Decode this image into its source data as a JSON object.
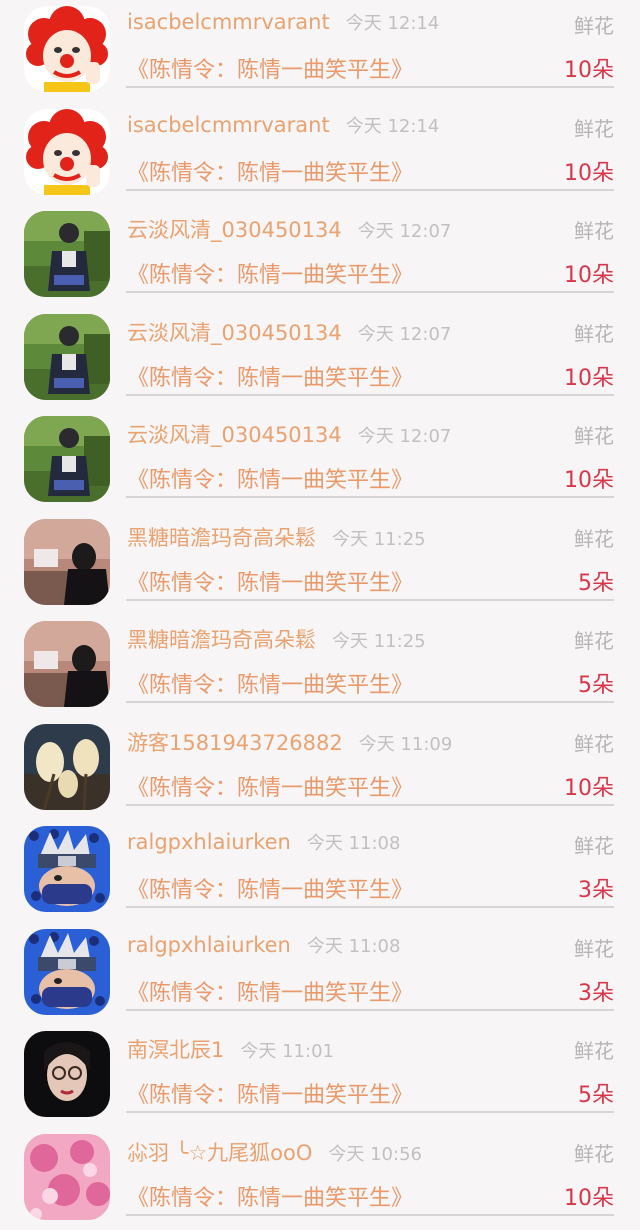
{
  "gift_list": [
    {
      "username": "isacbelcmmrvarant",
      "time": "今天 12:14",
      "gift_type": "鲜花",
      "work_title": "《陈情令：陈情一曲笑平生》",
      "count": "10朵",
      "avatar": "clown-avatar"
    },
    {
      "username": "isacbelcmmrvarant",
      "time": "今天 12:14",
      "gift_type": "鲜花",
      "work_title": "《陈情令：陈情一曲笑平生》",
      "count": "10朵",
      "avatar": "clown-avatar"
    },
    {
      "username": "云淡风清_030450134",
      "time": "今天 12:07",
      "gift_type": "鲜花",
      "work_title": "《陈情令：陈情一曲笑平生》",
      "count": "10朵",
      "avatar": "garden-person-avatar"
    },
    {
      "username": "云淡风清_030450134",
      "time": "今天 12:07",
      "gift_type": "鲜花",
      "work_title": "《陈情令：陈情一曲笑平生》",
      "count": "10朵",
      "avatar": "garden-person-avatar"
    },
    {
      "username": "云淡风清_030450134",
      "time": "今天 12:07",
      "gift_type": "鲜花",
      "work_title": "《陈情令：陈情一曲笑平生》",
      "count": "10朵",
      "avatar": "garden-person-avatar"
    },
    {
      "username": "黑糖暗澹玛奇高朵鬆",
      "time": "今天 11:25",
      "gift_type": "鲜花",
      "work_title": "《陈情令：陈情一曲笑平生》",
      "count": "5朵",
      "avatar": "dark-room-avatar"
    },
    {
      "username": "黑糖暗澹玛奇高朵鬆",
      "time": "今天 11:25",
      "gift_type": "鲜花",
      "work_title": "《陈情令：陈情一曲笑平生》",
      "count": "5朵",
      "avatar": "dark-room-avatar"
    },
    {
      "username": "游客1581943726882",
      "time": "今天 11:09",
      "gift_type": "鲜花",
      "work_title": "《陈情令：陈情一曲笑平生》",
      "count": "10朵",
      "avatar": "magnolia-avatar"
    },
    {
      "username": "ralgpxhlaiurken",
      "time": "今天 11:08",
      "gift_type": "鲜花",
      "work_title": "《陈情令：陈情一曲笑平生》",
      "count": "3朵",
      "avatar": "ninja-cartoon-avatar"
    },
    {
      "username": "ralgpxhlaiurken",
      "time": "今天 11:08",
      "gift_type": "鲜花",
      "work_title": "《陈情令：陈情一曲笑平生》",
      "count": "3朵",
      "avatar": "ninja-cartoon-avatar"
    },
    {
      "username": "南溟北辰1",
      "time": "今天 11:01",
      "gift_type": "鲜花",
      "work_title": "《陈情令：陈情一曲笑平生》",
      "count": "5朵",
      "avatar": "woman-glasses-avatar"
    },
    {
      "username": "尛羽 ╰☆九尾狐ooO",
      "time": "今天 10:56",
      "gift_type": "鲜花",
      "work_title": "《陈情令：陈情一曲笑平生》",
      "count": "10朵",
      "avatar": "pink-flowers-avatar"
    }
  ],
  "colors": {
    "background": "#f7f5f6",
    "username": "#e9a270",
    "work_title": "#ea9a6a",
    "count": "#d9364a",
    "muted": "#c4c0c0"
  }
}
